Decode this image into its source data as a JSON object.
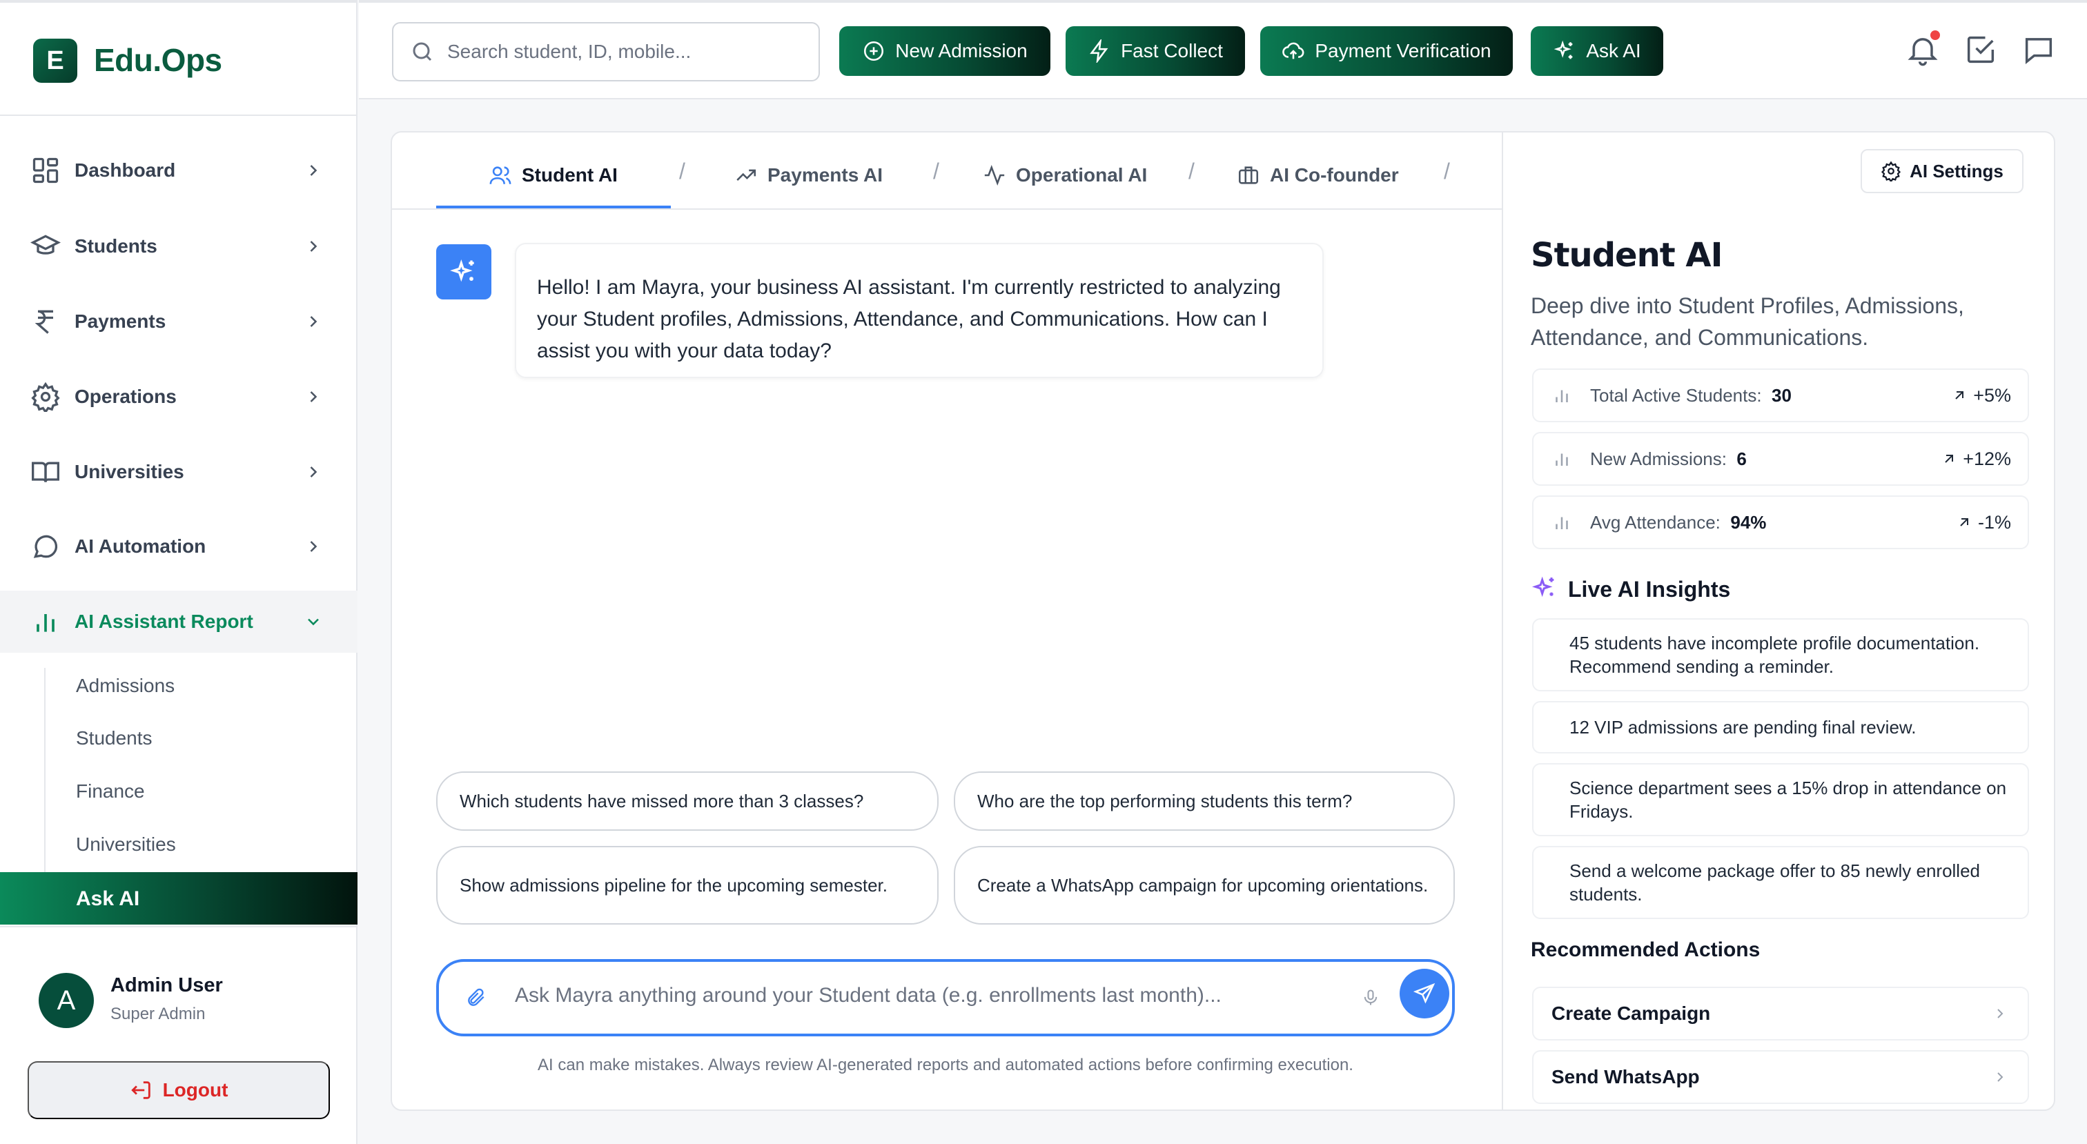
{
  "brand": {
    "logo_letter": "E",
    "name": "Edu.Ops",
    "accent": "#0a8a5c",
    "brand_dark": "#064a33"
  },
  "sidebar": {
    "items": [
      {
        "label": "Dashboard",
        "icon": "grid-icon"
      },
      {
        "label": "Students",
        "icon": "graduation-cap-icon"
      },
      {
        "label": "Payments",
        "icon": "rupee-icon"
      },
      {
        "label": "Operations",
        "icon": "gear-icon"
      },
      {
        "label": "Universities",
        "icon": "book-open-icon"
      },
      {
        "label": "AI Automation",
        "icon": "chat-bubble-icon"
      },
      {
        "label": "AI Assistant Report",
        "icon": "bar-chart-icon"
      }
    ],
    "sub_items": [
      "Admissions",
      "Students",
      "Finance",
      "Universities",
      "Ask AI"
    ],
    "user": {
      "avatar_letter": "A",
      "name": "Admin User",
      "role": "Super Admin"
    },
    "logout_label": "Logout"
  },
  "topbar": {
    "search_placeholder": "Search student, ID, mobile...",
    "buttons": [
      {
        "label": "New Admission",
        "icon": "plus-circle-icon"
      },
      {
        "label": "Fast Collect",
        "icon": "lightning-icon"
      },
      {
        "label": "Payment Verification",
        "icon": "cloud-upload-icon"
      },
      {
        "label": "Ask AI",
        "icon": "sparkles-icon"
      }
    ],
    "icons": [
      "bell-icon",
      "checkbox-icon",
      "message-icon"
    ]
  },
  "tabs": [
    {
      "label": "Student AI",
      "icon": "users-icon",
      "active": true
    },
    {
      "label": "Payments AI",
      "icon": "trending-up-icon"
    },
    {
      "label": "Operational AI",
      "icon": "activity-icon"
    },
    {
      "label": "AI Co-founder",
      "icon": "briefcase-icon"
    }
  ],
  "tab_separator": "/",
  "chat": {
    "greeting": "Hello! I am Mayra, your business AI assistant. I'm currently restricted to analyzing your Student profiles, Admissions, Attendance, and Communications. How can I assist you with your data today?",
    "suggestions": [
      "Which students have missed more than 3 classes?",
      "Who are the top performing students this term?",
      "Show admissions pipeline for the upcoming semester.",
      "Create a WhatsApp campaign for upcoming orientations."
    ],
    "input_placeholder": "Ask Mayra anything around your Student data (e.g. enrollments last month)...",
    "disclaimer": "AI can make mistakes. Always review AI-generated reports and automated actions before confirming execution."
  },
  "panel": {
    "settings_label": "AI Settings",
    "title": "Student AI",
    "description": "Deep dive into Student Profiles, Admissions, Attendance, and Communications.",
    "stats": [
      {
        "label": "Total Active Students:",
        "value": "30",
        "change": "+5%"
      },
      {
        "label": "New Admissions:",
        "value": "6",
        "change": "+12%"
      },
      {
        "label": "Avg Attendance:",
        "value": "94%",
        "change": "-1%"
      }
    ],
    "insights_title": "Live AI Insights",
    "insights": [
      "45 students have incomplete profile documentation. Recommend sending a reminder.",
      "12 VIP admissions are pending final review.",
      "Science department sees a 15% drop in attendance on Fridays.",
      "Send a welcome package offer to 85 newly enrolled students."
    ],
    "actions_title": "Recommended Actions",
    "actions": [
      "Create Campaign",
      "Send WhatsApp"
    ]
  }
}
